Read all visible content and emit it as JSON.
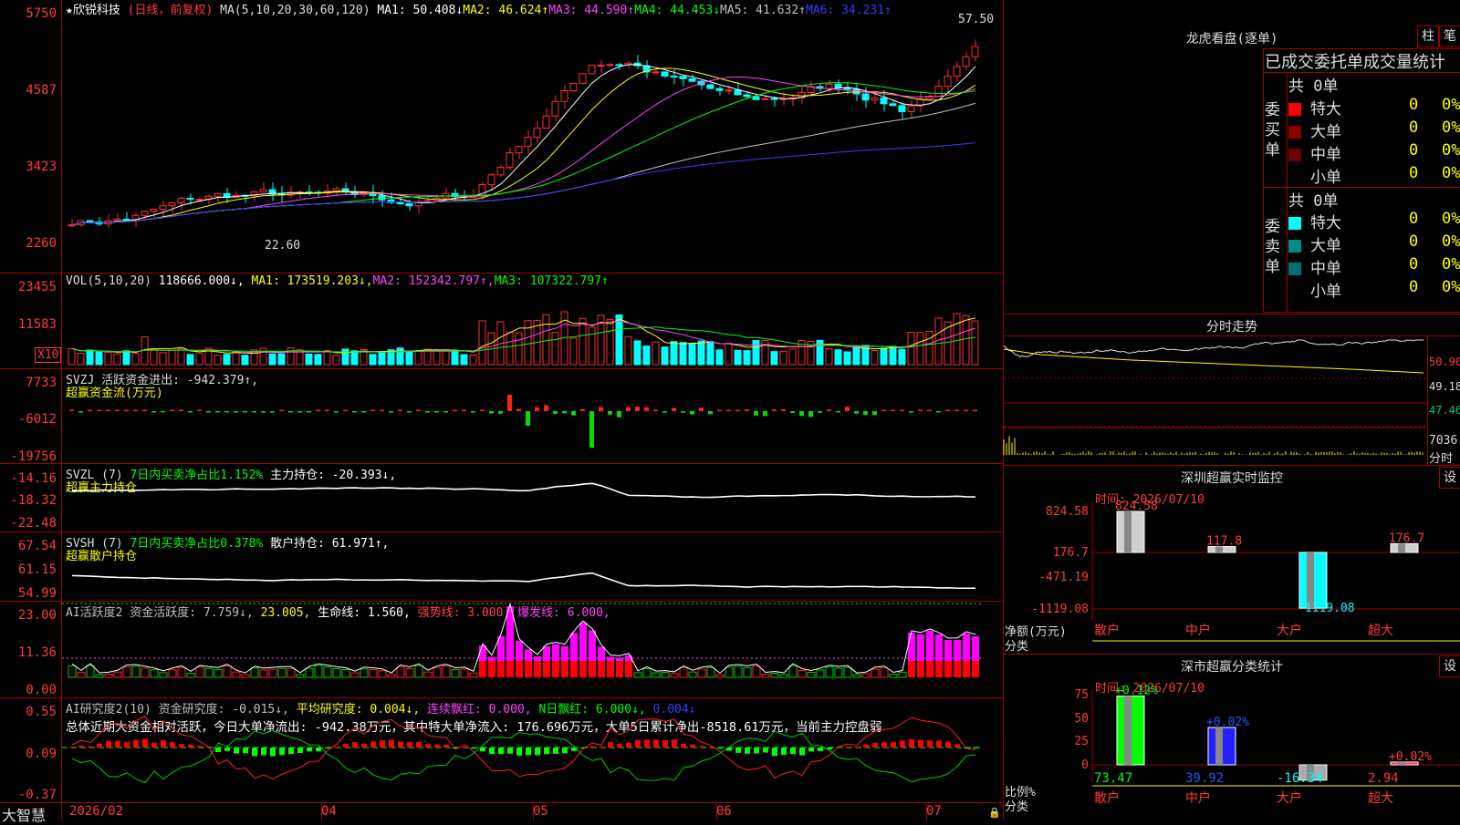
{
  "app": {
    "brand": "大智慧"
  },
  "main_chart": {
    "title_star": "★",
    "stock_name": "欣锐科技",
    "period": "(日线，前复权)",
    "ma_label": "MA(5,10,20,30,60,120)",
    "ma": [
      {
        "text": "MA1: 50.408↓",
        "color": "#ffffff"
      },
      {
        "text": "MA2: 46.624↑",
        "color": "#ffff00"
      },
      {
        "text": "MA3: 44.590↑",
        "color": "#ff44ff"
      },
      {
        "text": "MA4: 44.453↓",
        "color": "#00ff00"
      },
      {
        "text": "MA5: 41.632↑",
        "color": "#c0c0c0"
      },
      {
        "text": "MA6: 34.231↑",
        "color": "#3a3aff"
      }
    ],
    "y_ticks": [
      "5750",
      "4587",
      "3423",
      "2260"
    ],
    "high_label": "57.50",
    "low_label": "22.60"
  },
  "vol_chart": {
    "label": "VOL(5,10,20)",
    "value": "118666.000↓,",
    "ma": [
      {
        "text": "MA1: 173519.203↓,",
        "color": "#ffff00"
      },
      {
        "text": "MA2: 152342.797↑,",
        "color": "#ff44ff"
      },
      {
        "text": "MA3: 107322.797↑",
        "color": "#00ff00"
      }
    ],
    "y_ticks": [
      "23455",
      "11583"
    ],
    "unit": "X10"
  },
  "svzj": {
    "l1": "SVZJ  活跃资金进出: -942.379↑,",
    "l2": "超赢资金流(万元)",
    "y_ticks": [
      "7733",
      "-6012",
      "-19756"
    ]
  },
  "svzl": {
    "l1a": "SVZL (7)",
    "l1b": "7日内买卖净占比1.152%",
    "l1c": "主力持仓: -20.393↓,",
    "l2": "超赢主力持仓",
    "y_ticks": [
      "-14.16",
      "-18.32",
      "-22.48"
    ]
  },
  "svsh": {
    "l1a": "SVSH (7)",
    "l1b": "7日内买卖净占比0.378%",
    "l1c": "散户持仓: 61.971↑,",
    "l2": "超赢散户持仓",
    "y_ticks": [
      "67.54",
      "61.15",
      "54.99"
    ]
  },
  "ai_active": {
    "parts": [
      {
        "text": "AI活跃度2 资金活跃度: 7.759↓,",
        "color": "#c0c0c0"
      },
      {
        "text": " 23.005,",
        "color": "#ffff00"
      },
      {
        "text": " 生命线: 1.560,",
        "color": "#ffffff"
      },
      {
        "text": " 强势线: 3.000,",
        "color": "#ff4444"
      },
      {
        "text": " 爆发线: 6.000,",
        "color": "#ff44ff"
      }
    ],
    "y_ticks": [
      "23.00",
      "11.36",
      "0.00"
    ]
  },
  "ai_research": {
    "parts": [
      {
        "text": "AI研究度2(10) 资金研究度: -0.015↓,",
        "color": "#c0c0c0"
      },
      {
        "text": " 平均研究度: 0.004↓,",
        "color": "#ffff00"
      },
      {
        "text": " 连续飘红: 0.000,",
        "color": "#ff44ff"
      },
      {
        "text": " N日飘红: 6.000↓,",
        "color": "#00ff00"
      },
      {
        "text": " 0.004↓",
        "color": "#3a3aff"
      }
    ],
    "summary": "总体近期大资金相对活跃，今日大单净流出: -942.38万元，其中特大单净流入: 176.696万元，大单5日累计净出-8518.61万元，当前主力控盘弱",
    "y_ticks": [
      "0.55",
      "0.09",
      "-0.37"
    ]
  },
  "x_axis": [
    "2026/02",
    "04",
    "05",
    "06",
    "07"
  ],
  "right": {
    "lhb_title": "龙虎看盘(逐单)",
    "btn_bar": "柱",
    "btn_pen": "笔",
    "stat_title": "已成交委托单成交量统计",
    "buy_side": {
      "label": "委买单",
      "total": "共 0单",
      "rows": [
        {
          "name": "特大",
          "v": "0",
          "p": "0%",
          "color": "#ff0000"
        },
        {
          "name": "大单",
          "v": "0",
          "p": "0%",
          "color": "#8b0000"
        },
        {
          "name": "中单",
          "v": "0",
          "p": "0%",
          "color": "#6a0000"
        },
        {
          "name": "小单",
          "v": "0",
          "p": "0%",
          "color": ""
        }
      ]
    },
    "sell_side": {
      "label": "委卖单",
      "total": "共 0单",
      "rows": [
        {
          "name": "特大",
          "v": "0",
          "p": "0%",
          "color": "#00ffff"
        },
        {
          "name": "大单",
          "v": "0",
          "p": "0%",
          "color": "#008b8b"
        },
        {
          "name": "中单",
          "v": "0",
          "p": "0%",
          "color": "#007070"
        },
        {
          "name": "小单",
          "v": "0",
          "p": "0%",
          "color": ""
        }
      ]
    },
    "minute": {
      "title": "分时走势",
      "y_ticks": [
        "50.90",
        "49.18",
        "47.46"
      ],
      "vol_label": "7036",
      "vol_unit": "分时"
    },
    "sz_monitor": {
      "title": "深圳超赢实时监控",
      "btn": "设",
      "date": "时间: 2026/07/10",
      "y_ticks": [
        "824.58",
        "176.7",
        "-471.19",
        "-1119.08"
      ],
      "bars": [
        {
          "cat": "散户",
          "value": 824.58,
          "label": "824.58"
        },
        {
          "cat": "中户",
          "value": 117.8,
          "label": "117.8"
        },
        {
          "cat": "大户",
          "value": -1119.08,
          "label": "-1119.08"
        },
        {
          "cat": "超大",
          "value": 176.7,
          "label": "176.7"
        }
      ],
      "ylabel": "净额(万元)",
      "xlabel": "分类"
    },
    "sz_class": {
      "title": "深市超赢分类统计",
      "btn": "设",
      "date": "时间: 2026/07/10",
      "y_ticks": [
        "75",
        "50",
        "25",
        "0"
      ],
      "bars": [
        {
          "cat": "散户",
          "value": 73.47,
          "label": "73.47",
          "top": "+0.12%"
        },
        {
          "cat": "中户",
          "value": 39.92,
          "label": "39.92",
          "top": "+0.02%"
        },
        {
          "cat": "大户",
          "value": -16.34,
          "label": "-16.34",
          "top": ""
        },
        {
          "cat": "超大",
          "value": 2.94,
          "label": "2.94",
          "top": "+0.02%"
        }
      ],
      "ylabel": "比例%",
      "xlabel": "分类"
    }
  }
}
